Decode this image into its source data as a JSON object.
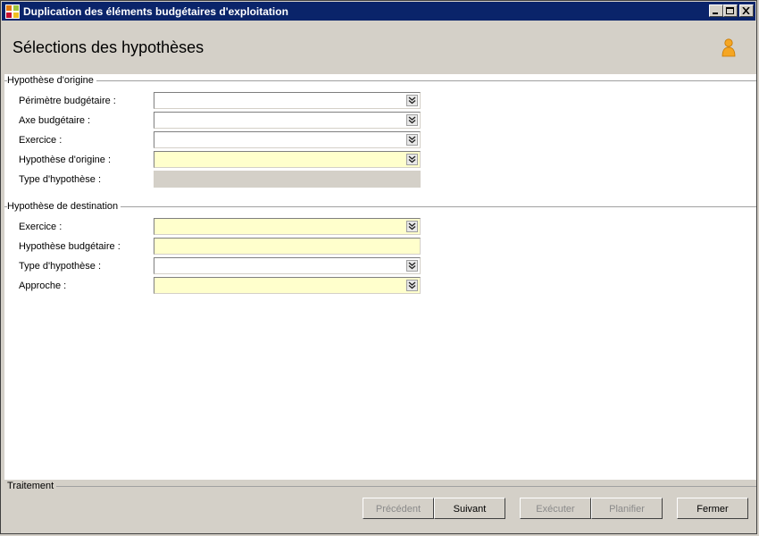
{
  "window": {
    "title": "Duplication des éléments budgétaires d'exploitation"
  },
  "header": {
    "title": "Sélections des hypothèses"
  },
  "origin_group": {
    "title": "Hypothèse d'origine",
    "fields": [
      {
        "label": "Périmètre budgétaire :",
        "value": "",
        "style": "white",
        "dropdown": true
      },
      {
        "label": "Axe budgétaire :",
        "value": "",
        "style": "white",
        "dropdown": true
      },
      {
        "label": "Exercice :",
        "value": "",
        "style": "white",
        "dropdown": true
      },
      {
        "label": "Hypothèse d'origine :",
        "value": "",
        "style": "yellow",
        "dropdown": true
      },
      {
        "label": "Type d'hypothèse :",
        "value": "",
        "style": "disabled",
        "dropdown": false
      }
    ]
  },
  "dest_group": {
    "title": "Hypothèse de destination",
    "fields": [
      {
        "label": "Exercice :",
        "value": "",
        "style": "yellow",
        "dropdown": true
      },
      {
        "label": "Hypothèse budgétaire :",
        "value": "",
        "style": "yellow",
        "dropdown": false
      },
      {
        "label": "Type d'hypothèse :",
        "value": "",
        "style": "white",
        "dropdown": true
      },
      {
        "label": "Approche :",
        "value": "",
        "style": "yellow",
        "dropdown": true
      }
    ]
  },
  "footer": {
    "title": "Traitement",
    "buttons": {
      "previous": "Précédent",
      "next": "Suivant",
      "execute": "Exécuter",
      "schedule": "Planifier",
      "close": "Fermer"
    }
  },
  "colors": {
    "titlebar": "#0a246a",
    "field_yellow": "#ffffcc",
    "window_bg": "#d4d0c8",
    "user_icon": "#f5a623"
  },
  "icons": {
    "app": "app-grid-icon",
    "user": "user-icon",
    "dropdown": "double-chevron-down-icon"
  }
}
